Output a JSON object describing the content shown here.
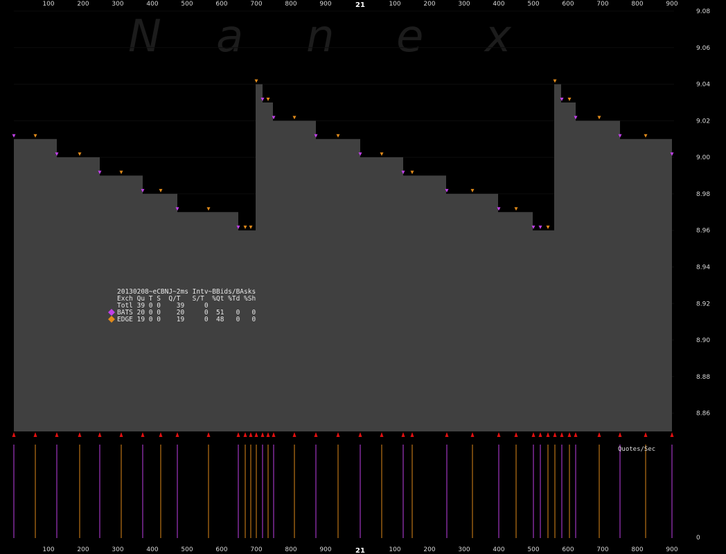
{
  "chart_data": {
    "type": "area",
    "title": "20130208~eCBNJ~2ms Intv~BBids/BAsks",
    "watermark_letters": [
      "N",
      "a",
      "n",
      "e",
      "x"
    ],
    "y_range": [
      8.85,
      9.08
    ],
    "y_ticks": [
      "9.08",
      "9.06",
      "9.04",
      "9.02",
      "9.00",
      "8.98",
      "8.96",
      "8.94",
      "8.92",
      "8.90",
      "8.88",
      "8.86"
    ],
    "x_tick_labels": [
      "100",
      "200",
      "300",
      "400",
      "500",
      "600",
      "700",
      "800",
      "900",
      "100",
      "200",
      "300",
      "400",
      "500",
      "600",
      "700",
      "800",
      "900"
    ],
    "x_second_label": "21",
    "bottom_axis_label": "Quotes/Sec",
    "bottom_axis_zero": "0",
    "colors": {
      "bats": "#c040e8",
      "edge": "#e08a1a",
      "fill": "#404040",
      "arrow": "#e01010"
    },
    "price_steps": [
      {
        "t": 0.0,
        "p": 9.01
      },
      {
        "t": 0.124,
        "p": 9.0
      },
      {
        "t": 0.248,
        "p": 8.99
      },
      {
        "t": 0.372,
        "p": 8.98
      },
      {
        "t": 0.472,
        "p": 8.97
      },
      {
        "t": 0.648,
        "p": 8.96
      },
      {
        "t": 0.698,
        "p": 9.04
      },
      {
        "t": 0.718,
        "p": 9.03
      },
      {
        "t": 0.748,
        "p": 9.02
      },
      {
        "t": 0.872,
        "p": 9.01
      },
      {
        "t": 1.0,
        "p": 9.0
      },
      {
        "t": 1.124,
        "p": 8.99
      },
      {
        "t": 1.248,
        "p": 8.98
      },
      {
        "t": 1.398,
        "p": 8.97
      },
      {
        "t": 1.498,
        "p": 8.96
      },
      {
        "t": 1.56,
        "p": 9.04
      },
      {
        "t": 1.58,
        "p": 9.03
      },
      {
        "t": 1.622,
        "p": 9.02
      },
      {
        "t": 1.75,
        "p": 9.01
      },
      {
        "t": 1.9,
        "p": 9.0
      }
    ],
    "t_end": 1.9,
    "quotes": [
      {
        "t": 0.0,
        "p": 9.01,
        "ex": "bats"
      },
      {
        "t": 0.062,
        "p": 9.01,
        "ex": "edge"
      },
      {
        "t": 0.124,
        "p": 9.0,
        "ex": "bats"
      },
      {
        "t": 0.19,
        "p": 9.0,
        "ex": "edge"
      },
      {
        "t": 0.248,
        "p": 8.99,
        "ex": "bats"
      },
      {
        "t": 0.31,
        "p": 8.99,
        "ex": "edge"
      },
      {
        "t": 0.372,
        "p": 8.98,
        "ex": "bats"
      },
      {
        "t": 0.424,
        "p": 8.98,
        "ex": "edge"
      },
      {
        "t": 0.472,
        "p": 8.97,
        "ex": "bats"
      },
      {
        "t": 0.562,
        "p": 8.97,
        "ex": "edge"
      },
      {
        "t": 0.648,
        "p": 8.96,
        "ex": "bats"
      },
      {
        "t": 0.668,
        "p": 8.96,
        "ex": "edge"
      },
      {
        "t": 0.684,
        "p": 8.96,
        "ex": "edge"
      },
      {
        "t": 0.7,
        "p": 9.04,
        "ex": "edge"
      },
      {
        "t": 0.718,
        "p": 9.03,
        "ex": "bats"
      },
      {
        "t": 0.734,
        "p": 9.03,
        "ex": "edge"
      },
      {
        "t": 0.75,
        "p": 9.02,
        "ex": "bats"
      },
      {
        "t": 0.81,
        "p": 9.02,
        "ex": "edge"
      },
      {
        "t": 0.872,
        "p": 9.01,
        "ex": "bats"
      },
      {
        "t": 0.936,
        "p": 9.01,
        "ex": "edge"
      },
      {
        "t": 1.0,
        "p": 9.0,
        "ex": "bats"
      },
      {
        "t": 1.062,
        "p": 9.0,
        "ex": "edge"
      },
      {
        "t": 1.124,
        "p": 8.99,
        "ex": "bats"
      },
      {
        "t": 1.15,
        "p": 8.99,
        "ex": "edge"
      },
      {
        "t": 1.25,
        "p": 8.98,
        "ex": "bats"
      },
      {
        "t": 1.324,
        "p": 8.98,
        "ex": "edge"
      },
      {
        "t": 1.4,
        "p": 8.97,
        "ex": "bats"
      },
      {
        "t": 1.45,
        "p": 8.97,
        "ex": "edge"
      },
      {
        "t": 1.5,
        "p": 8.96,
        "ex": "bats"
      },
      {
        "t": 1.52,
        "p": 8.96,
        "ex": "bats"
      },
      {
        "t": 1.542,
        "p": 8.96,
        "ex": "edge"
      },
      {
        "t": 1.562,
        "p": 9.04,
        "ex": "edge"
      },
      {
        "t": 1.582,
        "p": 9.03,
        "ex": "bats"
      },
      {
        "t": 1.604,
        "p": 9.03,
        "ex": "edge"
      },
      {
        "t": 1.622,
        "p": 9.02,
        "ex": "bats"
      },
      {
        "t": 1.69,
        "p": 9.02,
        "ex": "edge"
      },
      {
        "t": 1.75,
        "p": 9.01,
        "ex": "bats"
      },
      {
        "t": 1.824,
        "p": 9.01,
        "ex": "edge"
      },
      {
        "t": 1.9,
        "p": 9.0,
        "ex": "bats"
      }
    ],
    "legend": {
      "header": "Exch Qu T S  Q/T   S/T  %Qt %Td %Sh",
      "rows": [
        {
          "name": "Totl",
          "text": "Totl 39 0 0    39     0",
          "marker": null
        },
        {
          "name": "BATS",
          "text": "BATS 20 0 0    20     0  51   0   0",
          "marker": "bats"
        },
        {
          "name": "EDGE",
          "text": "EDGE 19 0 0    19     0  48   0   0",
          "marker": "edge"
        }
      ]
    }
  }
}
